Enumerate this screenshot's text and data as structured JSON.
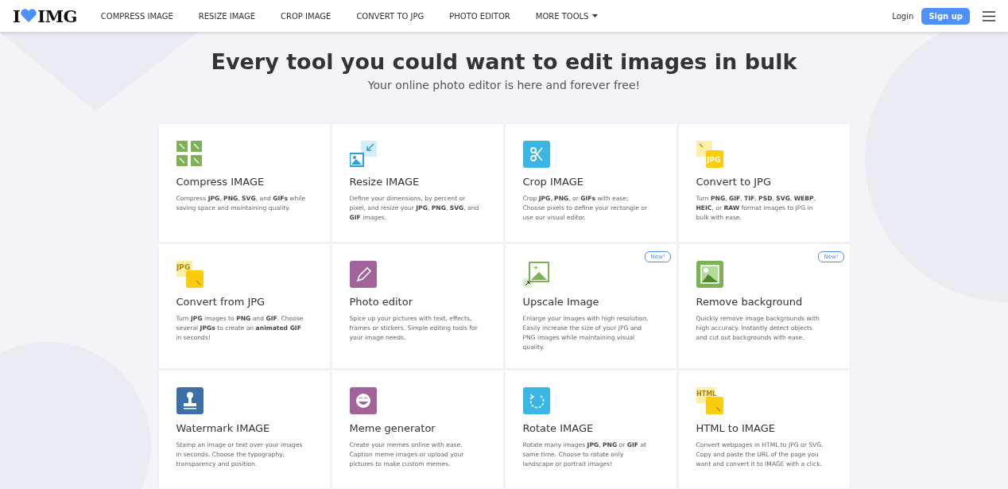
{
  "header": {
    "logo": {
      "left": "I",
      "right": "IMG"
    },
    "nav": [
      {
        "label": "COMPRESS IMAGE"
      },
      {
        "label": "RESIZE IMAGE"
      },
      {
        "label": "CROP IMAGE"
      },
      {
        "label": "CONVERT TO JPG"
      },
      {
        "label": "PHOTO EDITOR"
      },
      {
        "label": "MORE TOOLS",
        "dropdown": true
      }
    ],
    "login": "Login",
    "signup": "Sign up"
  },
  "hero": {
    "title": "Every tool you could want to edit images in bulk",
    "subtitle": "Your online photo editor is here and forever free!"
  },
  "tools": [
    {
      "kind": "compress",
      "title": "Compress IMAGE",
      "description": "Compress **JPG**, **PNG**, **SVG**, and **GIFs** while saving space and maintaining quality."
    },
    {
      "kind": "resize",
      "title": "Resize IMAGE",
      "description": "Define your dimensions, by percent or pixel, and resize your **JPG**, **PNG**, **SVG**, and **GIF** images."
    },
    {
      "kind": "crop",
      "title": "Crop IMAGE",
      "description": "Crop **JPG**, **PNG**, or **GIFs** with ease; Choose pixels to define your rectangle or use our visual editor."
    },
    {
      "kind": "to-jpg",
      "icon_text": "JPG",
      "title": "Convert to JPG",
      "description": "Turn **PNG**, **GIF**, **TIF**, **PSD**, **SVG**, **WEBP**, **HEIC**, or **RAW** format images to JPG in bulk with ease."
    },
    {
      "kind": "from-jpg",
      "icon_text": "JPG",
      "title": "Convert from JPG",
      "description": "Turn **JPG** images to **PNG** and **GIF**. Choose several **JPGs** to create an **animated GIF** in seconds!"
    },
    {
      "kind": "editor",
      "title": "Photo editor",
      "description": "Spice up your pictures with text, effects, frames or stickers. Simple editing tools for your image needs."
    },
    {
      "kind": "upscale",
      "badge": "New!",
      "title": "Upscale Image",
      "description": "Enlarge your images with high resolution. Easily increase the size of your JPG and PNG images while maintaining visual quality."
    },
    {
      "kind": "remove-bg",
      "badge": "New!",
      "title": "Remove background",
      "description": "Quickly remove image backgrounds with high accuracy. Instantly detect objects and cut out backgrounds with ease."
    },
    {
      "kind": "watermark",
      "title": "Watermark IMAGE",
      "description": "Stamp an image or text over your images in seconds. Choose the typography, transparency and position."
    },
    {
      "kind": "meme",
      "title": "Meme generator",
      "description": "Create your memes online with ease. Caption meme images or upload your pictures to make custom memes."
    },
    {
      "kind": "rotate",
      "title": "Rotate IMAGE",
      "description": "Rotate many images **JPG**, **PNG** or **GIF** at same time. Choose to rotate only landscape or portrait images!"
    },
    {
      "kind": "html",
      "icon_text": "HTML",
      "title": "HTML to IMAGE",
      "description": "Convert webpages in HTML to JPG or SVG. Copy and paste the URL of the page you want and convert it to IMAGE with a click."
    }
  ]
}
